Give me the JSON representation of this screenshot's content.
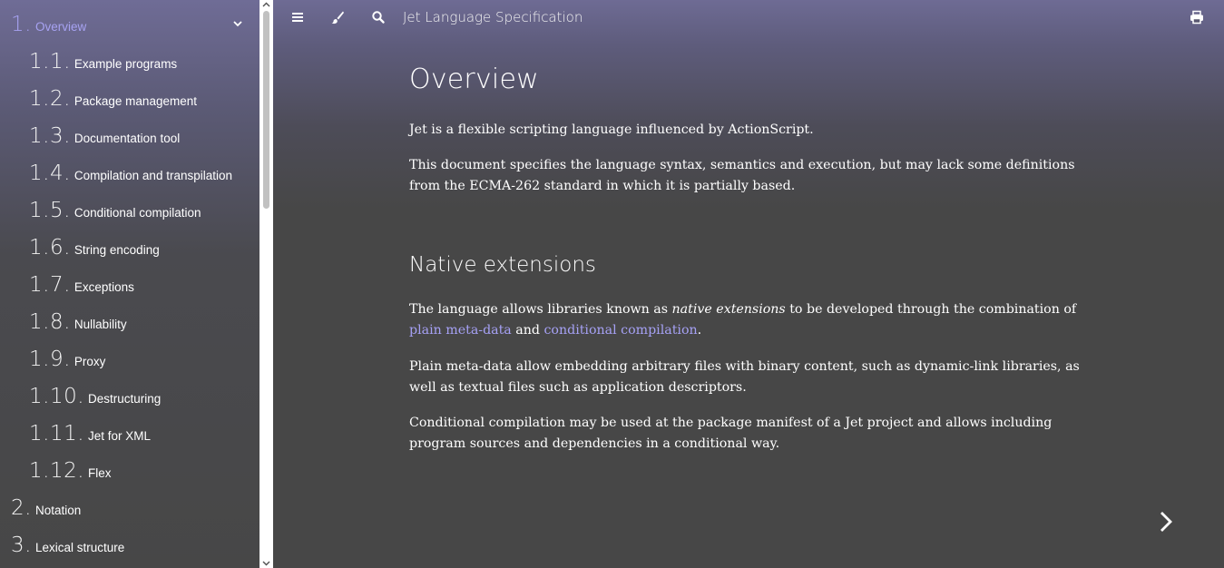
{
  "sidebar": {
    "items": [
      {
        "num": "1.",
        "label": "Overview",
        "level": 1,
        "active": true
      },
      {
        "num": "1.1.",
        "label": "Example programs",
        "level": 2
      },
      {
        "num": "1.2.",
        "label": "Package management",
        "level": 2
      },
      {
        "num": "1.3.",
        "label": "Documentation tool",
        "level": 2
      },
      {
        "num": "1.4.",
        "label": "Compilation and transpilation",
        "level": 2
      },
      {
        "num": "1.5.",
        "label": "Conditional compilation",
        "level": 2
      },
      {
        "num": "1.6.",
        "label": "String encoding",
        "level": 2
      },
      {
        "num": "1.7.",
        "label": "Exceptions",
        "level": 2
      },
      {
        "num": "1.8.",
        "label": "Nullability",
        "level": 2
      },
      {
        "num": "1.9.",
        "label": "Proxy",
        "level": 2
      },
      {
        "num": "1.10.",
        "label": "Destructuring",
        "level": 2
      },
      {
        "num": "1.11.",
        "label": "Jet for XML",
        "level": 2
      },
      {
        "num": "1.12.",
        "label": "Flex",
        "level": 2
      },
      {
        "num": "2.",
        "label": "Notation",
        "level": 1
      },
      {
        "num": "3.",
        "label": "Lexical structure",
        "level": 1
      }
    ]
  },
  "topbar": {
    "title": "Jet Language Specification",
    "icons": [
      "menu-icon",
      "brush-icon",
      "search-icon",
      "print-icon"
    ]
  },
  "content": {
    "title": "Overview",
    "p1": "Jet is a flexible scripting language influenced by ActionScript.",
    "p2": "This document specifies the language syntax, semantics and execution, but may lack some definitions from the ECMA-262 standard in which it is partially based.",
    "section_title": "Native extensions",
    "p3_before": "The language allows libraries known as ",
    "p3_em": "native extensions",
    "p3_mid": " to be developed through the combination of ",
    "p3_link1": "plain meta-data",
    "p3_and": " and ",
    "p3_link2": "conditional compilation",
    "p3_end": ".",
    "p4": "Plain meta-data allow embedding arbitrary files with binary content, such as dynamic-link libraries, as well as textual files such as application descriptors.",
    "p5": "Conditional compilation may be used at the package manifest of a Jet project and allows including program sources and dependencies in a conditional way."
  },
  "colors": {
    "accent": "#a7a2f2",
    "background": "#474747",
    "header_top": "#6f6c96"
  }
}
